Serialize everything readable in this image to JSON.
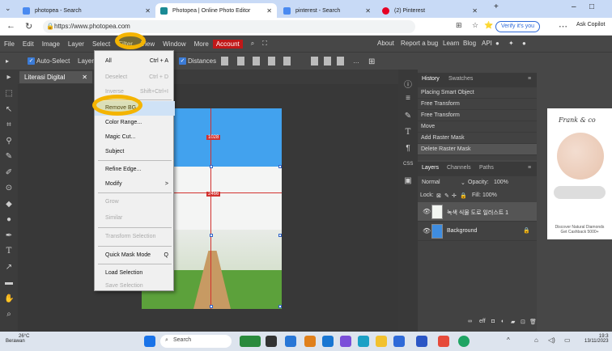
{
  "browser": {
    "tabs": [
      {
        "label": "photopea - Search",
        "color": "#4a8af0"
      },
      {
        "label": "Photopea | Online Photo Editor",
        "color": "#1a8a95"
      },
      {
        "label": "pinterest - Search",
        "color": "#4a8af0"
      },
      {
        "label": "(2) Pinterest",
        "color": "#e60023"
      }
    ],
    "new_tab": "+",
    "url": "https://www.photopea.com",
    "verify_label": "Verify it's you",
    "copilot_label": "Ask Copilot"
  },
  "menubar": {
    "items": [
      "File",
      "Edit",
      "Image",
      "Layer",
      "Select",
      "Filter",
      "View",
      "Window",
      "More"
    ],
    "account_label": "Account",
    "right_items": [
      "About",
      "Report a bug",
      "Learn",
      "Blog",
      "API"
    ]
  },
  "options": {
    "auto_select": "Auto-Select",
    "layer_select": "Layer",
    "distances": "Distances"
  },
  "document": {
    "tab_label": "Literasi Digital"
  },
  "canvas": {
    "measure_top": "1028",
    "measure_mid": "2466"
  },
  "select_menu": {
    "items": [
      {
        "label": "All",
        "shortcut": "Ctrl + A",
        "enabled": true
      },
      {
        "label": "Deselect",
        "shortcut": "Ctrl + D",
        "enabled": false
      },
      {
        "label": "Inverse",
        "shortcut": "Shift+Ctrl+I",
        "enabled": false
      },
      {
        "label": "Remove BG",
        "shortcut": "",
        "enabled": true
      },
      {
        "label": "Color Range...",
        "shortcut": "",
        "enabled": true
      },
      {
        "label": "Magic Cut...",
        "shortcut": "",
        "enabled": true
      },
      {
        "label": "Subject",
        "shortcut": "",
        "enabled": true
      },
      {
        "label": "Refine Edge...",
        "shortcut": "",
        "enabled": true
      },
      {
        "label": "Modify",
        "shortcut": ">",
        "enabled": true
      },
      {
        "label": "Grow",
        "shortcut": "",
        "enabled": false
      },
      {
        "label": "Similar",
        "shortcut": "",
        "enabled": false
      },
      {
        "label": "Transform Selection",
        "shortcut": "",
        "enabled": false
      },
      {
        "label": "Quick Mask Mode",
        "shortcut": "Q",
        "enabled": true
      },
      {
        "label": "Load Selection",
        "shortcut": "",
        "enabled": true
      },
      {
        "label": "Save Selection",
        "shortcut": "",
        "enabled": false
      }
    ]
  },
  "history": {
    "tabs": [
      "History",
      "Swatches"
    ],
    "items": [
      "Placing Smart Object",
      "Free Transform",
      "Free Transform",
      "Move",
      "Add Raster Mask",
      "Delete Raster Mask"
    ]
  },
  "layers": {
    "tabs": [
      "Layers",
      "Channels",
      "Paths"
    ],
    "blend_mode": "Normal",
    "opacity_label": "Opacity:",
    "opacity_value": "100%",
    "lock_label": "Lock:",
    "fill_label": "Fill:",
    "fill_value": "100%",
    "items": [
      {
        "name": "녹색 식물 도로 일러스트 1",
        "thumb": "#ffffff"
      },
      {
        "name": "Background",
        "thumb": "#3f8de0"
      }
    ],
    "css_label": "CSS"
  },
  "ad": {
    "title": "Frank & co",
    "text": "Discover Natural Diamonds",
    "sub": "Get Cashback 5000+"
  },
  "taskbar": {
    "temp": "26°C",
    "weather": "Berawan",
    "search_placeholder": "Search",
    "time": "19:3",
    "date": "13/11/2023"
  },
  "colors": {
    "accent_blue": "#3b7bd6",
    "account_red": "#c01818",
    "marker_yellow": "#f4b400",
    "guide_red": "#d2322f"
  }
}
